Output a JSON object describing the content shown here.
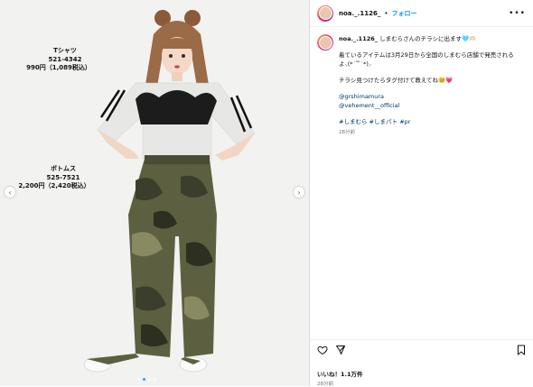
{
  "post": {
    "tshirt": {
      "label": "Tシャツ",
      "code": "521-4342",
      "price": "990円（1,089税込）"
    },
    "bottoms": {
      "label": "ボトムス",
      "code": "525-7521",
      "price": "2,200円（2,420税込）"
    }
  },
  "header": {
    "username": "noa._.1126_",
    "separator": "•",
    "follow": "フォロー",
    "more": "•••"
  },
  "caption": {
    "username": "noa._.1126_",
    "line1": "しまむらさんのチラシに出ます🩵🫶🏻",
    "line2": "着ているアイテムは3月29日から全国のしまむら店舗で発売されるよ⸜︎︎︎︎︎︎︎︎︎︎︎︎︎︎︎︎︎︎︎︎︎︎︎︎︎(*˙꒳˙*)⸝",
    "line3": "チラシ見つけたらタグ付けて教えてね🥺💗",
    "mention1": "@grshimamura",
    "mention2": "@vehement__official",
    "hashtags": "#しまむら #しまパト #pr",
    "time": "28分前"
  },
  "footer": {
    "likes": "いいね！1.1万件",
    "date": "28分前"
  },
  "colors": {
    "follow": "#0095f6",
    "link": "#00376b",
    "muted": "#737373"
  }
}
